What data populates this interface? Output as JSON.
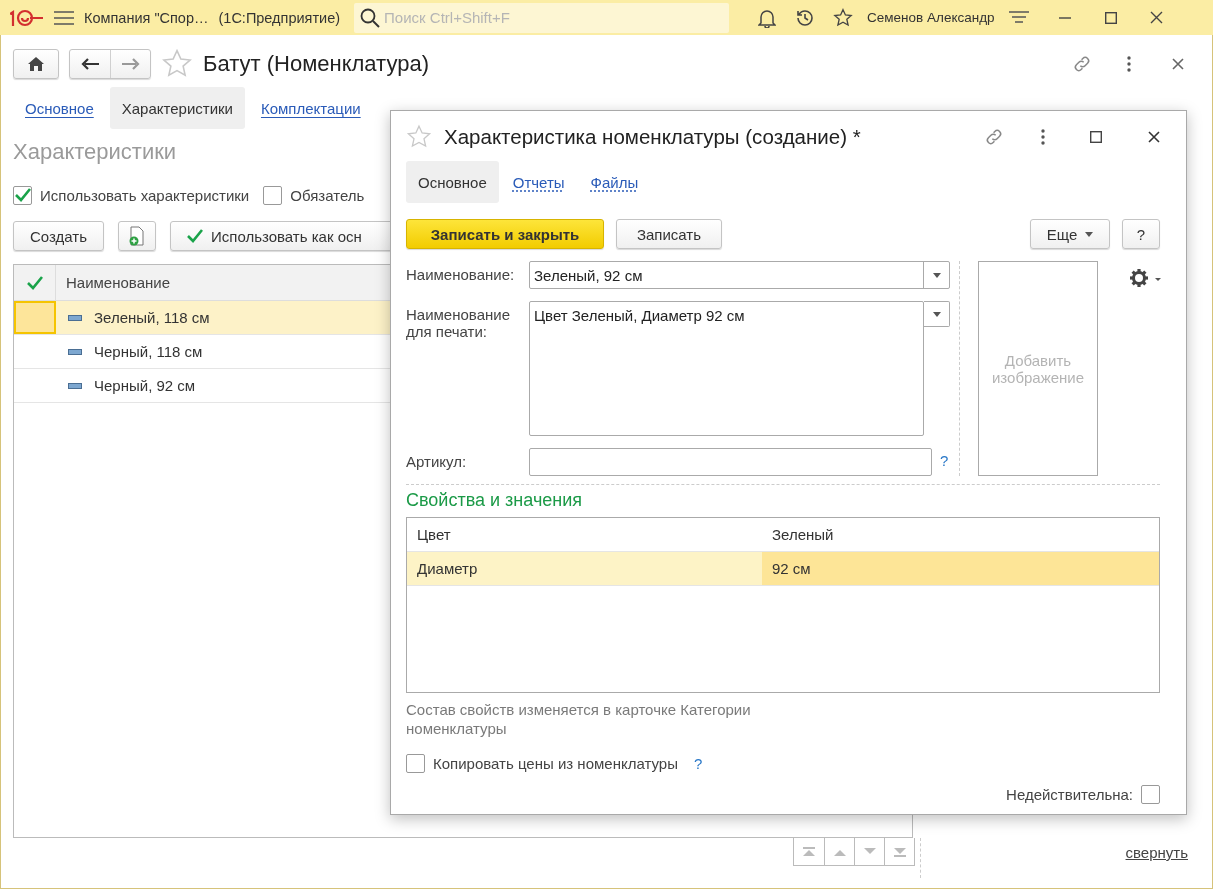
{
  "topbar": {
    "company": "Компания \"Спор…",
    "app": "(1С:Предприятие)",
    "search": {
      "placeholder": "Поиск Ctrl+Shift+F"
    },
    "user": "Семенов Александр"
  },
  "form": {
    "title": "Батут (Номенклатура)",
    "tabs": [
      {
        "label": "Основное",
        "selected": false
      },
      {
        "label": "Характеристики",
        "selected": true
      },
      {
        "label": "Комплектации",
        "selected": false
      }
    ],
    "section_title": "Характеристики",
    "checkboxes": [
      {
        "label": "Использовать характеристики",
        "checked": true
      },
      {
        "label": "Обязатель",
        "checked": false
      }
    ],
    "create_button": "Создать",
    "use_button": "Использовать как осн",
    "table": {
      "columns": [
        "Наименование"
      ],
      "rows": [
        {
          "name": "Зеленый, 118 см",
          "selected": true
        },
        {
          "name": "Черный, 118 см",
          "selected": false
        },
        {
          "name": "Черный, 92 см",
          "selected": false
        }
      ]
    },
    "collapse_link": "свернуть"
  },
  "dialog": {
    "title": "Характеристика номенклатуры (создание) *",
    "tabs": [
      {
        "label": "Основное",
        "selected": true
      },
      {
        "label": "Отчеты",
        "selected": false
      },
      {
        "label": "Файлы",
        "selected": false
      }
    ],
    "save_close_button": "Записать и закрыть",
    "save_button": "Записать",
    "more_button": "Еще",
    "help_button": "?",
    "name": {
      "label": "Наименование:",
      "value": "Зеленый, 92 см"
    },
    "print_name": {
      "label": "Наименование для печати:",
      "value": "Цвет Зеленый, Диаметр 92 см"
    },
    "article": {
      "label": "Артикул:",
      "hint": "?"
    },
    "image_placeholder": "Добавить изображение",
    "properties": {
      "title": "Свойства и значения",
      "rows": [
        {
          "name": "Цвет",
          "value": "Зеленый",
          "selected": false
        },
        {
          "name": "Диаметр",
          "value": "92 см",
          "selected": true
        }
      ]
    },
    "note": "Состав свойств изменяется в карточке Категории номенклатуры",
    "copy_prices": {
      "label": "Копировать цены из номенклатуры",
      "checked": false,
      "hint": "?"
    },
    "invalid": {
      "label": "Недействительна:",
      "checked": false
    }
  }
}
